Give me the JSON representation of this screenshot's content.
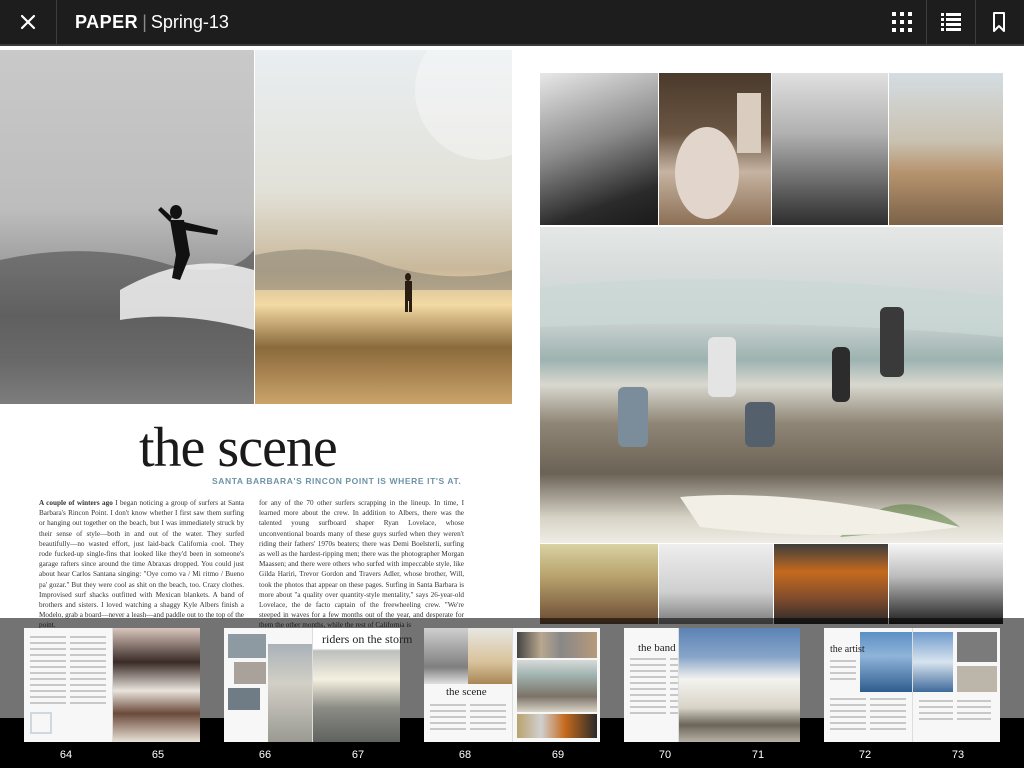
{
  "topbar": {
    "brand": "PAPER",
    "separator": "|",
    "issue": "Spring-13"
  },
  "icons": {
    "close": "close-icon",
    "grid": "grid-icon",
    "list": "list-icon",
    "bookmark": "bookmark-icon"
  },
  "article": {
    "headline": "the scene",
    "subhead": "SANTA BARBARA'S RINCON POINT IS WHERE IT'S AT.",
    "col1_lead": "A couple of winters ago",
    "col1_text": " I began noticing a group of surfers at Santa Barbara's Rincon Point. I don't know whether I first saw them surfing or hanging out together on the beach, but I was immediately struck by their sense of style—both in and out of the water. They surfed beautifully—no wasted effort, just laid-back California cool. They rode fucked-up single-fins that looked like they'd been in someone's garage rafters since around the time Abraxas dropped. You could just about hear Carlos Santana singing: \"Oye como va / Mi ritmo / Bueno pa' gozar.\" But they were cool as shit on the beach, too. Crazy clothes. Improvised surf shacks outfitted with Mexican blankets. A band of brothers and sisters. I loved watching a shaggy Kyle Albers finish a Modelo, grab a board—never a leash—and paddle out to the top of the point.",
    "col2_text": "for any of the 70 other surfers scrapping in the lineup. In time, I learned more about the crew. In addition to Albers, there was the talented young surfboard shaper Ryan Lovelace, whose unconventional boards many of these guys surfed when they weren't riding their fathers' 1970s beaters; there was Demi Boelsterli, surfing as well as the hardest-ripping men; there was the photographer Morgan Maassen; and there were others who surfed with impeccable style, like Gilda Hariri, Trevor Gordon and Travers Adler, whose brother, Will, took the photos that appear on these pages. Surfing in Santa Barbara is more about \"a quality over quantity-style mentality,\" says 26-year-old Lovelace, the de facto captain of the freewheeling crew. \"We're steeped in waves for a few months out of the year, and desperate for them the other months, while the rest of California is"
  },
  "thumbnails": [
    {
      "left_page": "64",
      "right_page": "65",
      "title": ""
    },
    {
      "left_page": "66",
      "right_page": "67",
      "title": "riders on the storm"
    },
    {
      "left_page": "68",
      "right_page": "69",
      "title": "the scene"
    },
    {
      "left_page": "70",
      "right_page": "71",
      "title": "the band"
    },
    {
      "left_page": "72",
      "right_page": "73",
      "title": "the artist"
    }
  ]
}
